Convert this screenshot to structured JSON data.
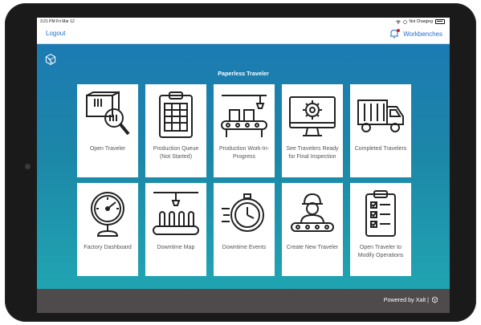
{
  "status_bar": {
    "time_date": "3:21 PM   Fri Mar 12",
    "battery_status": "Not Charging"
  },
  "header": {
    "logout_label": "Logout",
    "workbenches_label": "Workbenches"
  },
  "app_title": "Paperless Traveler",
  "tiles": [
    {
      "label": "Open Traveler",
      "icon": "open-traveler-icon"
    },
    {
      "label": "Production Queue (Not Started)",
      "icon": "production-queue-icon"
    },
    {
      "label": "Production Work-In-Progress",
      "icon": "production-wip-icon"
    },
    {
      "label": "See Travelers Ready for Final Inspection",
      "icon": "final-inspection-icon"
    },
    {
      "label": "Completed Travelers",
      "icon": "truck-icon"
    },
    {
      "label": "Factory Dashboard",
      "icon": "gauge-icon"
    },
    {
      "label": "Downtime Map",
      "icon": "downtime-map-icon"
    },
    {
      "label": "Downtime Events",
      "icon": "stopwatch-icon"
    },
    {
      "label": "Create New Traveler",
      "icon": "worker-icon"
    },
    {
      "label": "Open Traveler to Modify Operations",
      "icon": "checklist-icon"
    }
  ],
  "footer": {
    "powered_by": "Powered by Xalt  |"
  },
  "colors": {
    "accent": "#1f6fd1",
    "footer": "#4f4a4c",
    "gradient_top": "#1b78b5",
    "gradient_bottom": "#21aab3"
  }
}
